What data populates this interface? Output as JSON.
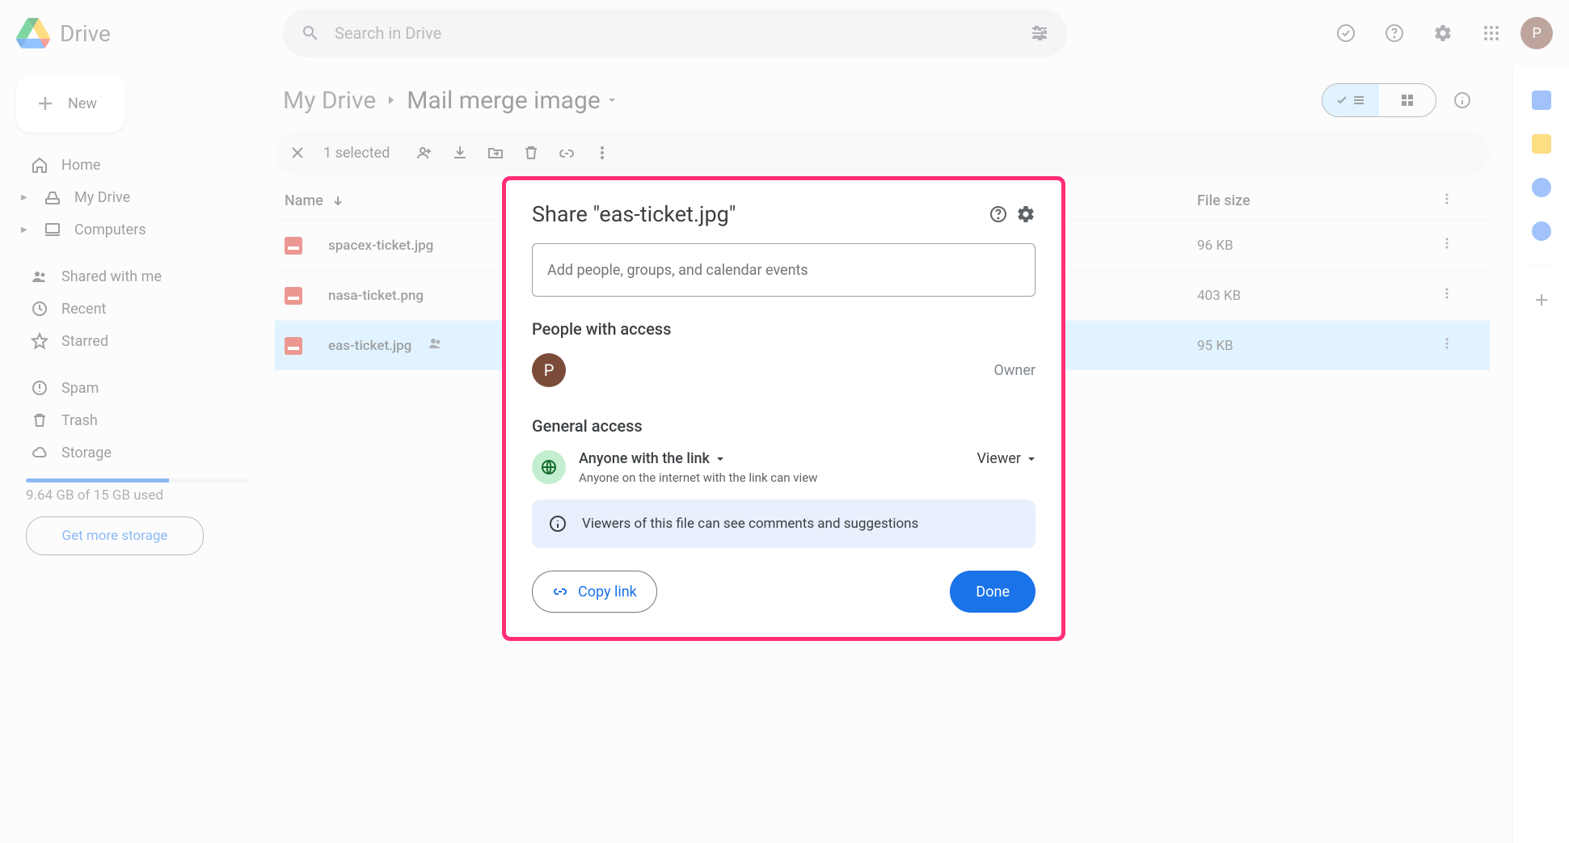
{
  "app": {
    "name": "Drive"
  },
  "search": {
    "placeholder": "Search in Drive"
  },
  "header": {
    "avatar_letter": "P"
  },
  "new_button": {
    "label": "New"
  },
  "sidebar": {
    "items": [
      {
        "label": "Home"
      },
      {
        "label": "My Drive"
      },
      {
        "label": "Computers"
      },
      {
        "label": "Shared with me"
      },
      {
        "label": "Recent"
      },
      {
        "label": "Starred"
      },
      {
        "label": "Spam"
      },
      {
        "label": "Trash"
      },
      {
        "label": "Storage"
      }
    ],
    "storage_used": "9.64 GB of 15 GB used",
    "storage_cta": "Get more storage",
    "storage_pct": 64
  },
  "breadcrumb": {
    "root": "My Drive",
    "current": "Mail merge image"
  },
  "actionbar": {
    "selected_text": "1 selected"
  },
  "table": {
    "columns": {
      "name": "Name",
      "size": "File size"
    },
    "rows": [
      {
        "name": "spacex-ticket.jpg",
        "size": "96 KB",
        "shared": false,
        "selected": false
      },
      {
        "name": "nasa-ticket.png",
        "size": "403 KB",
        "shared": false,
        "selected": false
      },
      {
        "name": "eas-ticket.jpg",
        "size": "95 KB",
        "shared": true,
        "selected": true
      }
    ]
  },
  "modal": {
    "title": "Share \"eas-ticket.jpg\"",
    "add_placeholder": "Add people, groups, and calendar events",
    "people_title": "People with access",
    "owner_letter": "P",
    "owner_role": "Owner",
    "general_title": "General access",
    "link_scope": "Anyone with the link",
    "link_desc": "Anyone on the internet with the link can view",
    "role": "Viewer",
    "info": "Viewers of this file can see comments and suggestions",
    "copy": "Copy link",
    "done": "Done"
  }
}
